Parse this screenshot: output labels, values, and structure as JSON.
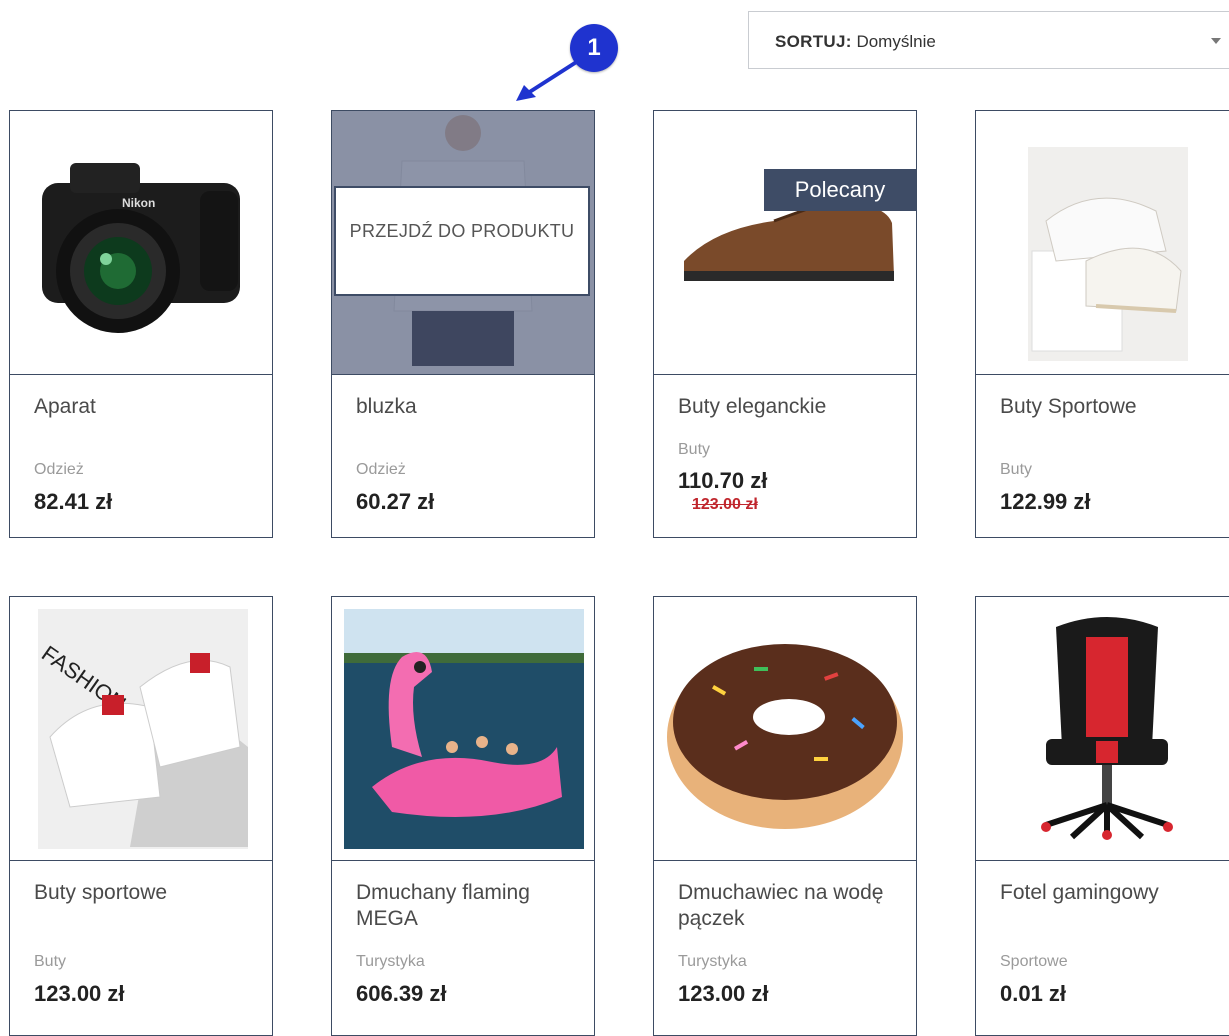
{
  "sort": {
    "label": "SORTUJ:",
    "value": "Domyślnie"
  },
  "annotation": {
    "marker": "1"
  },
  "hover": {
    "button": "PRZEJDŹ DO PRODUKTU"
  },
  "products": [
    {
      "name": "Aparat",
      "category": "Odzież",
      "price": "82.41 zł"
    },
    {
      "name": "bluzka",
      "category": "Odzież",
      "price": "60.27 zł"
    },
    {
      "name": "Buty eleganckie",
      "category": "Buty",
      "price": "110.70 zł",
      "old_price": "123.00 zł",
      "badge": "Polecany"
    },
    {
      "name": "Buty Sportowe",
      "category": "Buty",
      "price": "122.99 zł"
    },
    {
      "name": "Buty sportowe",
      "category": "Buty",
      "price": "123.00 zł"
    },
    {
      "name": "Dmuchany flaming MEGA",
      "category": "Turystyka",
      "price": "606.39 zł"
    },
    {
      "name": "Dmuchawiec na wodę pączek",
      "category": "Turystyka",
      "price": "123.00 zł"
    },
    {
      "name": "Fotel gamingowy",
      "category": "Sportowe",
      "price": "0.01 zł"
    }
  ],
  "colors": {
    "border": "#3d4b63",
    "badge": "#3e4c66",
    "marker": "#1f33cf",
    "old_price": "#c0262d"
  }
}
